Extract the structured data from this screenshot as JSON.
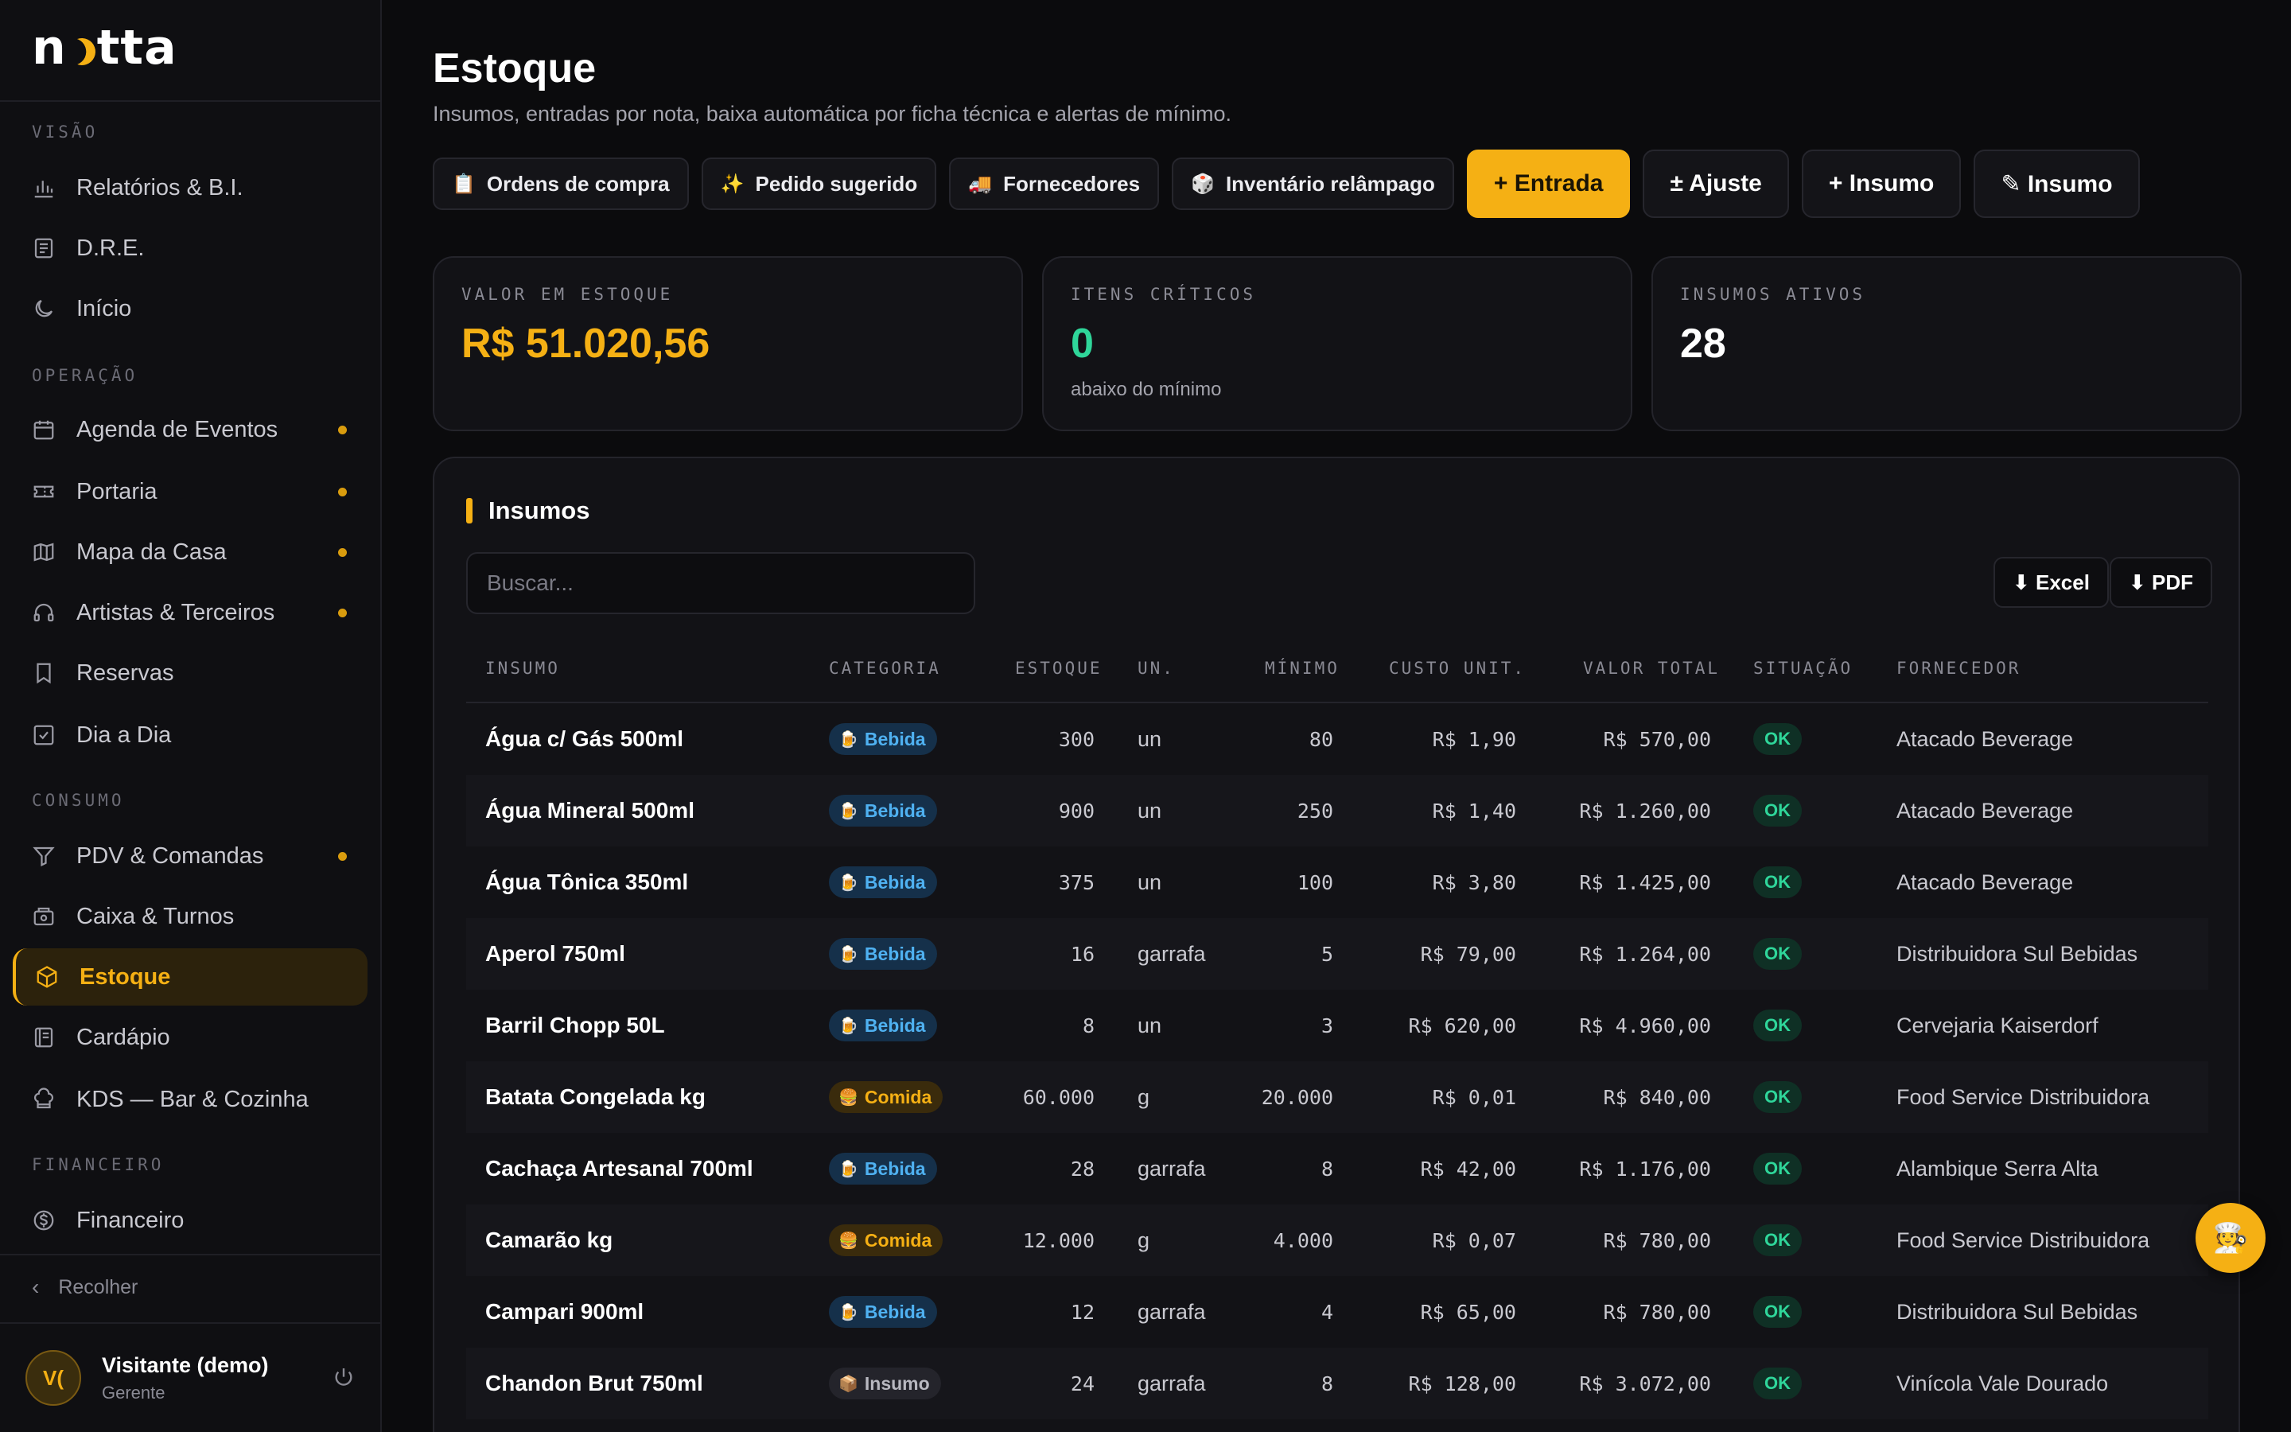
{
  "app": {
    "logo_text_left": "n",
    "logo_text_right": "tta"
  },
  "sidebar": {
    "sections": [
      {
        "label": "VISÃO"
      },
      {
        "label": "OPERAÇÃO"
      },
      {
        "label": "CONSUMO"
      },
      {
        "label": "FINANCEIRO"
      }
    ],
    "items": [
      {
        "label": "Relatórios & B.I.",
        "icon": "chart-bars-icon",
        "dot": false
      },
      {
        "label": "D.R.E.",
        "icon": "document-icon",
        "dot": false
      },
      {
        "label": "Início",
        "icon": "moon-icon",
        "dot": false
      },
      {
        "label": "Agenda de Eventos",
        "icon": "calendar-icon",
        "dot": true
      },
      {
        "label": "Portaria",
        "icon": "ticket-icon",
        "dot": true
      },
      {
        "label": "Mapa da Casa",
        "icon": "map-icon",
        "dot": true
      },
      {
        "label": "Artistas & Terceiros",
        "icon": "headphones-icon",
        "dot": true
      },
      {
        "label": "Reservas",
        "icon": "bookmark-icon",
        "dot": false
      },
      {
        "label": "Dia a Dia",
        "icon": "check-square-icon",
        "dot": false
      },
      {
        "label": "PDV & Comandas",
        "icon": "funnel-icon",
        "dot": true
      },
      {
        "label": "Caixa & Turnos",
        "icon": "cash-register-icon",
        "dot": false
      },
      {
        "label": "Estoque",
        "icon": "box-icon",
        "dot": false,
        "active": true
      },
      {
        "label": "Cardápio",
        "icon": "menu-book-icon",
        "dot": false
      },
      {
        "label": "KDS — Bar & Cozinha",
        "icon": "chef-hat-icon",
        "dot": false
      },
      {
        "label": "Financeiro",
        "icon": "dollar-circle-icon",
        "dot": false
      }
    ],
    "collapse_label": "Recolher",
    "user": {
      "initials": "V(",
      "name": "Visitante (demo)",
      "role": "Gerente"
    }
  },
  "page": {
    "title": "Estoque",
    "subtitle": "Insumos, entradas por nota, baixa automática por ficha técnica e alertas de mínimo."
  },
  "toolbar": {
    "small": [
      {
        "emoji": "📋",
        "label": "Ordens de compra"
      },
      {
        "emoji": "✨",
        "label": "Pedido sugerido"
      },
      {
        "emoji": "🚚",
        "label": "Fornecedores"
      },
      {
        "emoji": "🎲",
        "label": "Inventário relâmpago"
      }
    ],
    "entrada": "+ Entrada",
    "ajuste": "± Ajuste",
    "insumo_add": "+ Insumo",
    "insumo_edit": "✎ Insumo"
  },
  "cards": [
    {
      "label": "VALOR EM ESTOQUE",
      "value": "R$ 51.020,56",
      "note": "",
      "color": "#f5b014"
    },
    {
      "label": "ITENS CRÍTICOS",
      "value": "0",
      "note": "abaixo do mínimo",
      "color": "#2fd69a"
    },
    {
      "label": "INSUMOS ATIVOS",
      "value": "28",
      "note": "",
      "color": "#ffffff"
    }
  ],
  "panel": {
    "title": "Insumos",
    "search_placeholder": "Buscar...",
    "excel": "⬇ Excel",
    "pdf": "⬇ PDF"
  },
  "table": {
    "columns": [
      "INSUMO",
      "CATEGORIA",
      "ESTOQUE",
      "UN.",
      "MÍNIMO",
      "CUSTO UNIT.",
      "VALOR TOTAL",
      "SITUAÇÃO",
      "FORNECEDOR"
    ],
    "rows": [
      {
        "insumo": "Água c/ Gás 500ml",
        "categoria": "Bebida",
        "cat_type": "bebida",
        "estoque": "300",
        "un": "un",
        "minimo": "80",
        "custo": "R$ 1,90",
        "total": "R$ 570,00",
        "situacao": "OK",
        "fornecedor": "Atacado Beverage"
      },
      {
        "insumo": "Água Mineral 500ml",
        "categoria": "Bebida",
        "cat_type": "bebida",
        "estoque": "900",
        "un": "un",
        "minimo": "250",
        "custo": "R$ 1,40",
        "total": "R$ 1.260,00",
        "situacao": "OK",
        "fornecedor": "Atacado Beverage"
      },
      {
        "insumo": "Água Tônica 350ml",
        "categoria": "Bebida",
        "cat_type": "bebida",
        "estoque": "375",
        "un": "un",
        "minimo": "100",
        "custo": "R$ 3,80",
        "total": "R$ 1.425,00",
        "situacao": "OK",
        "fornecedor": "Atacado Beverage"
      },
      {
        "insumo": "Aperol 750ml",
        "categoria": "Bebida",
        "cat_type": "bebida",
        "estoque": "16",
        "un": "garrafa",
        "minimo": "5",
        "custo": "R$ 79,00",
        "total": "R$ 1.264,00",
        "situacao": "OK",
        "fornecedor": "Distribuidora Sul Bebidas"
      },
      {
        "insumo": "Barril Chopp 50L",
        "categoria": "Bebida",
        "cat_type": "bebida",
        "estoque": "8",
        "un": "un",
        "minimo": "3",
        "custo": "R$ 620,00",
        "total": "R$ 4.960,00",
        "situacao": "OK",
        "fornecedor": "Cervejaria Kaiserdorf"
      },
      {
        "insumo": "Batata Congelada kg",
        "categoria": "Comida",
        "cat_type": "comida",
        "estoque": "60.000",
        "un": "g",
        "minimo": "20.000",
        "custo": "R$ 0,01",
        "total": "R$ 840,00",
        "situacao": "OK",
        "fornecedor": "Food Service Distribuidora"
      },
      {
        "insumo": "Cachaça Artesanal 700ml",
        "categoria": "Bebida",
        "cat_type": "bebida",
        "estoque": "28",
        "un": "garrafa",
        "minimo": "8",
        "custo": "R$ 42,00",
        "total": "R$ 1.176,00",
        "situacao": "OK",
        "fornecedor": "Alambique Serra Alta"
      },
      {
        "insumo": "Camarão kg",
        "categoria": "Comida",
        "cat_type": "comida",
        "estoque": "12.000",
        "un": "g",
        "minimo": "4.000",
        "custo": "R$ 0,07",
        "total": "R$ 780,00",
        "situacao": "OK",
        "fornecedor": "Food Service Distribuidora"
      },
      {
        "insumo": "Campari 900ml",
        "categoria": "Bebida",
        "cat_type": "bebida",
        "estoque": "12",
        "un": "garrafa",
        "minimo": "4",
        "custo": "R$ 65,00",
        "total": "R$ 780,00",
        "situacao": "OK",
        "fornecedor": "Distribuidora Sul Bebidas"
      },
      {
        "insumo": "Chandon Brut 750ml",
        "categoria": "Insumo",
        "cat_type": "insumo",
        "estoque": "24",
        "un": "garrafa",
        "minimo": "8",
        "custo": "R$ 128,00",
        "total": "R$ 3.072,00",
        "situacao": "OK",
        "fornecedor": "Vinícola Vale Dourado"
      }
    ]
  },
  "fab": {
    "emoji": "🧑‍🍳"
  },
  "colors": {
    "accent": "#f5b014",
    "ok": "#2fd69a",
    "bebida": "#4fb1f1"
  }
}
